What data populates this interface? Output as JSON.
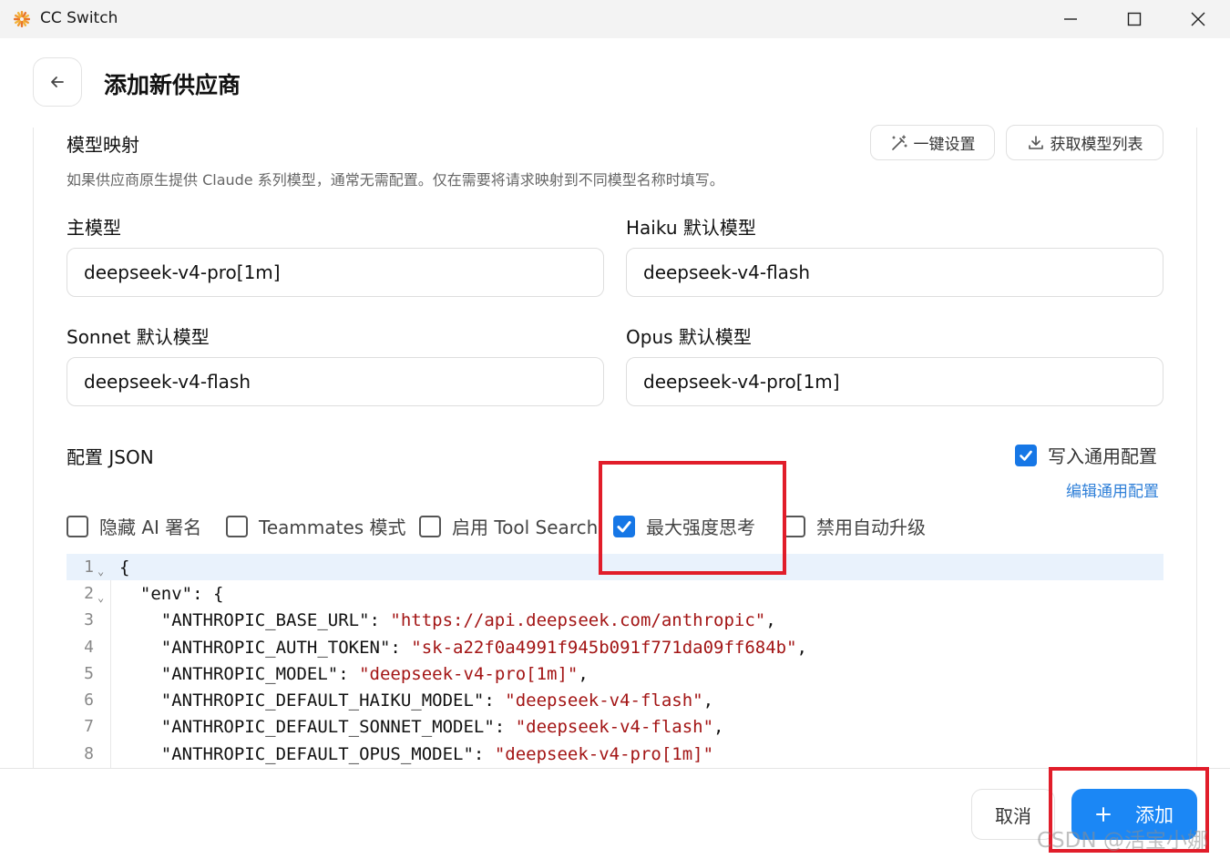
{
  "window": {
    "title": "CC Switch",
    "icon": "sunburst-app-icon",
    "controls": [
      "minimize-icon",
      "maximize-icon",
      "close-icon"
    ]
  },
  "header": {
    "title": "添加新供应商"
  },
  "model_mapping": {
    "title": "模型映射",
    "description": "如果供应商原生提供 Claude 系列模型，通常无需配置。仅在需要将请求映射到不同模型名称时填写。",
    "oneclick_label": "一键设置",
    "fetch_label": "获取模型列表",
    "fields": {
      "main": {
        "label": "主模型",
        "value": "deepseek-v4-pro[1m]"
      },
      "haiku": {
        "label": "Haiku 默认模型",
        "value": "deepseek-v4-flash"
      },
      "sonnet": {
        "label": "Sonnet 默认模型",
        "value": "deepseek-v4-flash"
      },
      "opus": {
        "label": "Opus 默认模型",
        "value": "deepseek-v4-pro[1m]"
      }
    }
  },
  "config_json": {
    "title": "配置 JSON",
    "write_common_label": "写入通用配置",
    "write_common_checked": true,
    "edit_common_label": "编辑通用配置",
    "options": [
      {
        "label": "隐藏 AI 署名",
        "checked": false
      },
      {
        "label": "Teammates 模式",
        "checked": false
      },
      {
        "label": "启用 Tool Search",
        "checked": false
      },
      {
        "label": "最大强度思考",
        "checked": true
      },
      {
        "label": "禁用自动升级",
        "checked": false
      }
    ]
  },
  "editor": {
    "lines": [
      {
        "n": "1",
        "fold": true,
        "key": "{",
        "val": "",
        "tail": ""
      },
      {
        "n": "2",
        "fold": true,
        "key": "  \"env\": {",
        "val": "",
        "tail": ""
      },
      {
        "n": "3",
        "fold": false,
        "key": "    \"ANTHROPIC_BASE_URL\": ",
        "val": "\"https://api.deepseek.com/anthropic\"",
        "tail": ","
      },
      {
        "n": "4",
        "fold": false,
        "key": "    \"ANTHROPIC_AUTH_TOKEN\": ",
        "val": "\"sk-a22f0a4991f945b091f771da09ff684b\"",
        "tail": ","
      },
      {
        "n": "5",
        "fold": false,
        "key": "    \"ANTHROPIC_MODEL\": ",
        "val": "\"deepseek-v4-pro[1m]\"",
        "tail": ","
      },
      {
        "n": "6",
        "fold": false,
        "key": "    \"ANTHROPIC_DEFAULT_HAIKU_MODEL\": ",
        "val": "\"deepseek-v4-flash\"",
        "tail": ","
      },
      {
        "n": "7",
        "fold": false,
        "key": "    \"ANTHROPIC_DEFAULT_SONNET_MODEL\": ",
        "val": "\"deepseek-v4-flash\"",
        "tail": ","
      },
      {
        "n": "8",
        "fold": false,
        "key": "    \"ANTHROPIC_DEFAULT_OPUS_MODEL\": ",
        "val": "\"deepseek-v4-pro[1m]\"",
        "tail": ""
      }
    ]
  },
  "footer": {
    "cancel_label": "取消",
    "add_label": "添加"
  },
  "watermark": "CSDN @活宝小娜",
  "colors": {
    "accent": "#1b87f5",
    "highlight": "#e11d2a",
    "string": "#a31515"
  }
}
